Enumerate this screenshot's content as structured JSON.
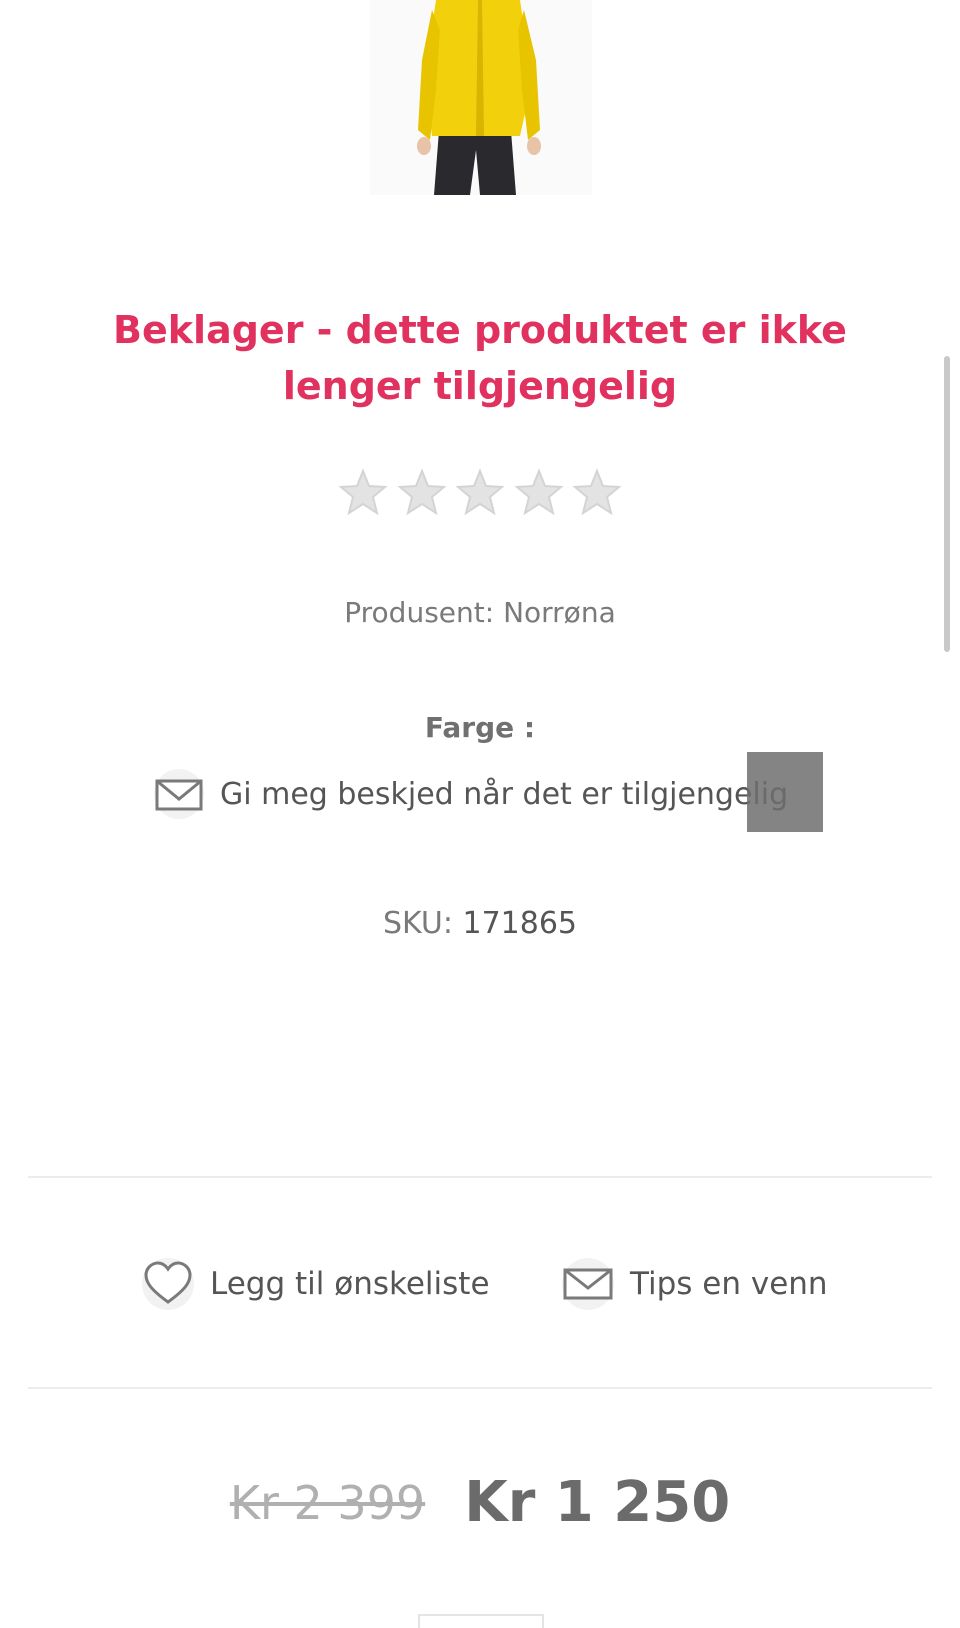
{
  "product": {
    "unavailable_title": "Beklager - dette produktet er ikke lenger tilgjengelig",
    "rating_stars": 0,
    "rating_max": 5,
    "manufacturer_text": "Produsent: Norrøna",
    "color_label": "Farge :",
    "notify_text": "Gi meg beskjed når det er tilgjengelig",
    "sku_label": "SKU:",
    "sku_value": "171865"
  },
  "actions": {
    "wishlist_label": "Legg til ønskeliste",
    "tip_label": "Tips en venn"
  },
  "pricing": {
    "old_price": "Kr 2 399",
    "new_price": "Kr 1 250"
  },
  "icons": {
    "notify": "mail-icon",
    "wishlist": "heart-icon",
    "tip": "mail-icon",
    "rating": "star-icon"
  },
  "colors": {
    "title": "#e0315f",
    "text": "#6b6b6b",
    "product_yellow": "#f2d10c"
  }
}
